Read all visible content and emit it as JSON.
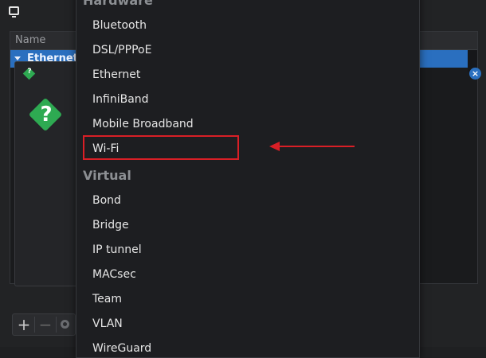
{
  "window": {
    "list_header": "Name",
    "selected_row": "Ethernet"
  },
  "menu": {
    "sections": [
      {
        "label": "Hardware",
        "items": [
          "Bluetooth",
          "DSL/PPPoE",
          "Ethernet",
          "InfiniBand",
          "Mobile Broadband",
          "Wi-Fi"
        ]
      },
      {
        "label": "Virtual",
        "items": [
          "Bond",
          "Bridge",
          "IP tunnel",
          "MACsec",
          "Team",
          "VLAN",
          "WireGuard"
        ]
      }
    ]
  },
  "toolbar": {
    "add": "+",
    "remove": "−"
  },
  "icons": {
    "window": "network-icon",
    "dialog": "question-icon",
    "clear": "close-icon",
    "settings": "gear-icon"
  },
  "colors": {
    "highlight": "#d91f26",
    "selection": "#2a6fbf"
  }
}
